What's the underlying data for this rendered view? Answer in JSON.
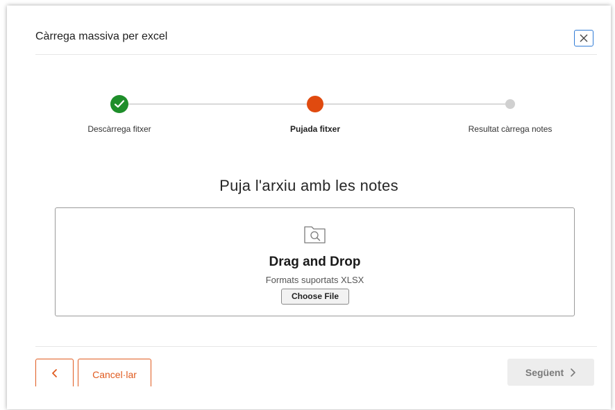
{
  "modal": {
    "title": "Càrrega massiva per excel"
  },
  "stepper": {
    "steps": [
      {
        "label": "Descàrrega fitxer",
        "status": "completed",
        "color": "#1e8e2a"
      },
      {
        "label": "Pujada fitxer",
        "status": "active",
        "color": "#e04a0f"
      },
      {
        "label": "Resultat càrrega notes",
        "status": "pending",
        "color": "#d0d0d0"
      }
    ]
  },
  "upload": {
    "heading": "Puja l'arxiu amb les notes",
    "dropzone_title": "Drag and Drop",
    "formats_text": "Formats suportats XLSX",
    "choose_file_label": "Choose File",
    "icon": "folder-search-icon"
  },
  "footer": {
    "back_icon": "chevron-left-icon",
    "cancel_label": "Cancel·lar",
    "next_label": "Següent",
    "next_icon": "chevron-right-icon"
  },
  "colors": {
    "accent": "#e05a1e",
    "close_border": "#2f7bd6"
  }
}
